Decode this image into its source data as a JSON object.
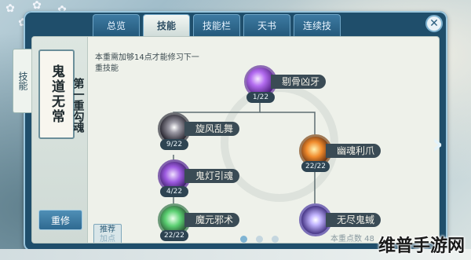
{
  "tabs": [
    {
      "label": "总览",
      "active": false
    },
    {
      "label": "技能",
      "active": true
    },
    {
      "label": "技能栏",
      "active": false
    },
    {
      "label": "天书",
      "active": false
    },
    {
      "label": "连续技",
      "active": false
    }
  ],
  "side_tab": {
    "label": "技能"
  },
  "character": {
    "portrait_text": "鬼道无常",
    "realm_label": "第一重勾魂",
    "reset_label": "重修",
    "recommend_label": "推荐",
    "recommend_sub": "加点"
  },
  "hint": "本重需加够14点才能修习下一重技能",
  "skills": [
    {
      "name": "剔骨凶牙",
      "count": "1/22",
      "color": "purple"
    },
    {
      "name": "旋风乱舞",
      "count": "9/22",
      "color": "dark"
    },
    {
      "name": "幽魂利爪",
      "count": "22/22",
      "color": "fire"
    },
    {
      "name": "鬼灯引魂",
      "count": "4/22",
      "color": "violet"
    },
    {
      "name": "魔元邪术",
      "count": "22/22",
      "color": "green"
    },
    {
      "name": "无尽鬼蜮",
      "count": "",
      "color": "star"
    }
  ],
  "points_label": "本重点数 48",
  "watermark": "维普手游网",
  "icons": {
    "close": "close-icon",
    "next": "chevron-right-icon"
  }
}
